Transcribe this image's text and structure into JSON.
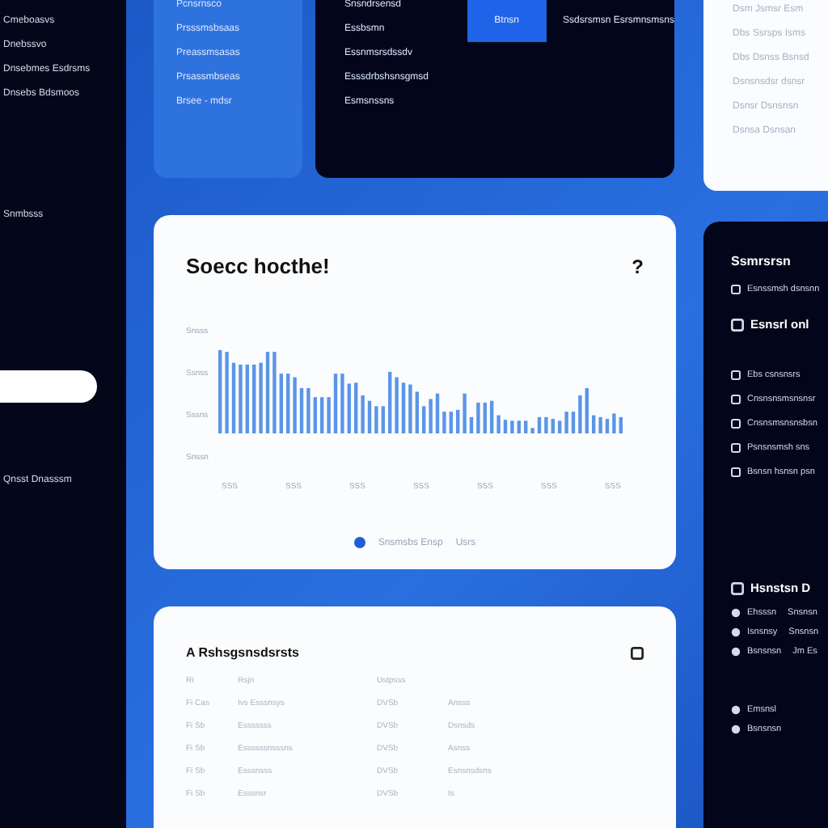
{
  "sidebar": {
    "items": [
      "Cmeboasvs",
      "Dnebssvo",
      "Dnsebmes Esdrsms",
      "Dnsebs Bdsmoos"
    ],
    "section": "Snmbsss",
    "footer": "Qnsst Dnasssm"
  },
  "blue_panel": {
    "items": [
      "Pcnsrnsco",
      "Prsssmsbsaas",
      "Preassmsasas",
      "Prsassmbseas",
      "Brsee - mdsr"
    ]
  },
  "dark_card": {
    "items": [
      "Snsndrsensd",
      "Essbsmn",
      "Essnmsrsdssdv",
      "Esssdrbshsnsgmsd",
      "Esmsnssns"
    ],
    "button": "Btnsn",
    "note": "Ssdsrsmsn Esrsmnsmsns"
  },
  "list_card": {
    "items": [
      "Dsm Jsmsr Esm",
      "Dbs Ssrsps Isms",
      "Dbs Dsnss Bsnsd",
      "Dsnsnsdsr dsnsr",
      "Dsnsr Dsnsnsn",
      "Dsnsa Dsnsan"
    ]
  },
  "chart_card": {
    "title": "Soecc hocthe!",
    "help": "?",
    "y_labels": [
      "Snsss",
      "Ssnss",
      "Sssns",
      "Snssn"
    ],
    "x_labels": [
      "SSS",
      "SSS",
      "SSS",
      "SSS",
      "SSS",
      "SSS",
      "SSS"
    ],
    "legend": [
      {
        "label": "Snsmsbs Ensp",
        "color": "#1f5fd6"
      },
      {
        "label": "Usrs"
      }
    ]
  },
  "table_card": {
    "title": "A Rshsgsnsdsrsts",
    "header": [
      "Ri",
      "Rsjn",
      "Ustpsss"
    ],
    "rows": [
      [
        "Fi Cas",
        "Ivs Esssnsys",
        "DVSb",
        "Ansss"
      ],
      [
        "Fi Sb",
        "Esssssss",
        "DVSb",
        "Dsnsds"
      ],
      [
        "Fi Sb",
        "Essssssnsssns",
        "DVSb",
        "Asnss"
      ],
      [
        "Fi Sb",
        "Esssnsss",
        "DVSb",
        "Esnsnsdsns"
      ],
      [
        "Fi Sb",
        "Esssnsr",
        "DVSb",
        "Is"
      ]
    ]
  },
  "right_panel": {
    "title": "Ssmrsrsn",
    "subtitle": "Esnssmsh dsnsnn",
    "section_1": "Esnsrl onl",
    "items_1": [
      "Ebs csnsnsrs",
      "Cnsnsnsmsnsnsr",
      "Cnsnsmsnsnsbsn",
      "Psnsnsmsh sns",
      "Bsnsn hsnsn psn"
    ],
    "section_2": "Hsnstsn D",
    "items_2": [
      {
        "label": "Ehsssn",
        "value": "Snsnsn"
      },
      {
        "label": "Isnsnsy",
        "value": "Snsnsn"
      },
      {
        "label": "Bsnsnsn",
        "value": "Jm Es"
      }
    ],
    "items_3": [
      "Emsnsl",
      "Bsnsnsn"
    ]
  }
}
